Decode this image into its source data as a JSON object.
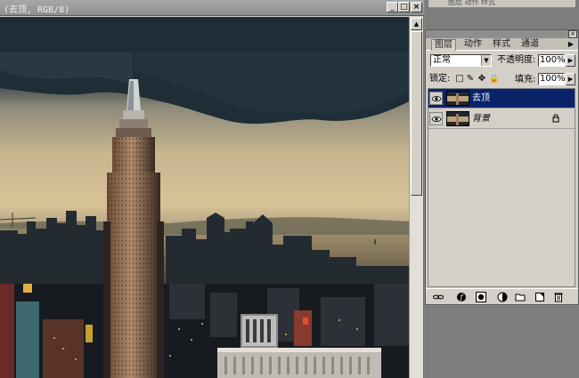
{
  "document": {
    "title": "(去顶, RGB/8)",
    "buttons": {
      "minimize": "_",
      "maximize": "□",
      "close": "×"
    }
  },
  "scrollbar": {
    "up_arrow": "▲"
  },
  "top_strip": {
    "text": "图层  动作  样式"
  },
  "layers_panel": {
    "close_label": "×",
    "menu_arrow": "▶",
    "tabs": [
      {
        "label": "图层",
        "active": true
      },
      {
        "label": "动作",
        "active": false
      },
      {
        "label": "样式",
        "active": false
      },
      {
        "label": "通道",
        "active": false
      }
    ],
    "blend_mode": "正常",
    "blend_arrow": "▼",
    "opacity_label": "不透明度:",
    "opacity_value": "100%",
    "lock_label": "锁定:",
    "lock_icons": [
      "□",
      "✎",
      "✥",
      "🔒"
    ],
    "fill_label": "填充:",
    "fill_value": "100%",
    "stepper_arrow": "▶",
    "layers": [
      {
        "name": "去顶",
        "selected": true,
        "italic": false,
        "locked": false
      },
      {
        "name": "背景",
        "selected": false,
        "italic": true,
        "locked": true
      }
    ],
    "footer_icons": [
      "link-icon",
      "layer-style-icon",
      "mask-icon",
      "adjustment-icon",
      "folder-icon",
      "new-layer-icon",
      "trash-icon"
    ]
  },
  "colors": {
    "selected_layer": "#0a246a",
    "panel_bg": "#d4d0c8",
    "titlebar": "#8e8e8e"
  }
}
